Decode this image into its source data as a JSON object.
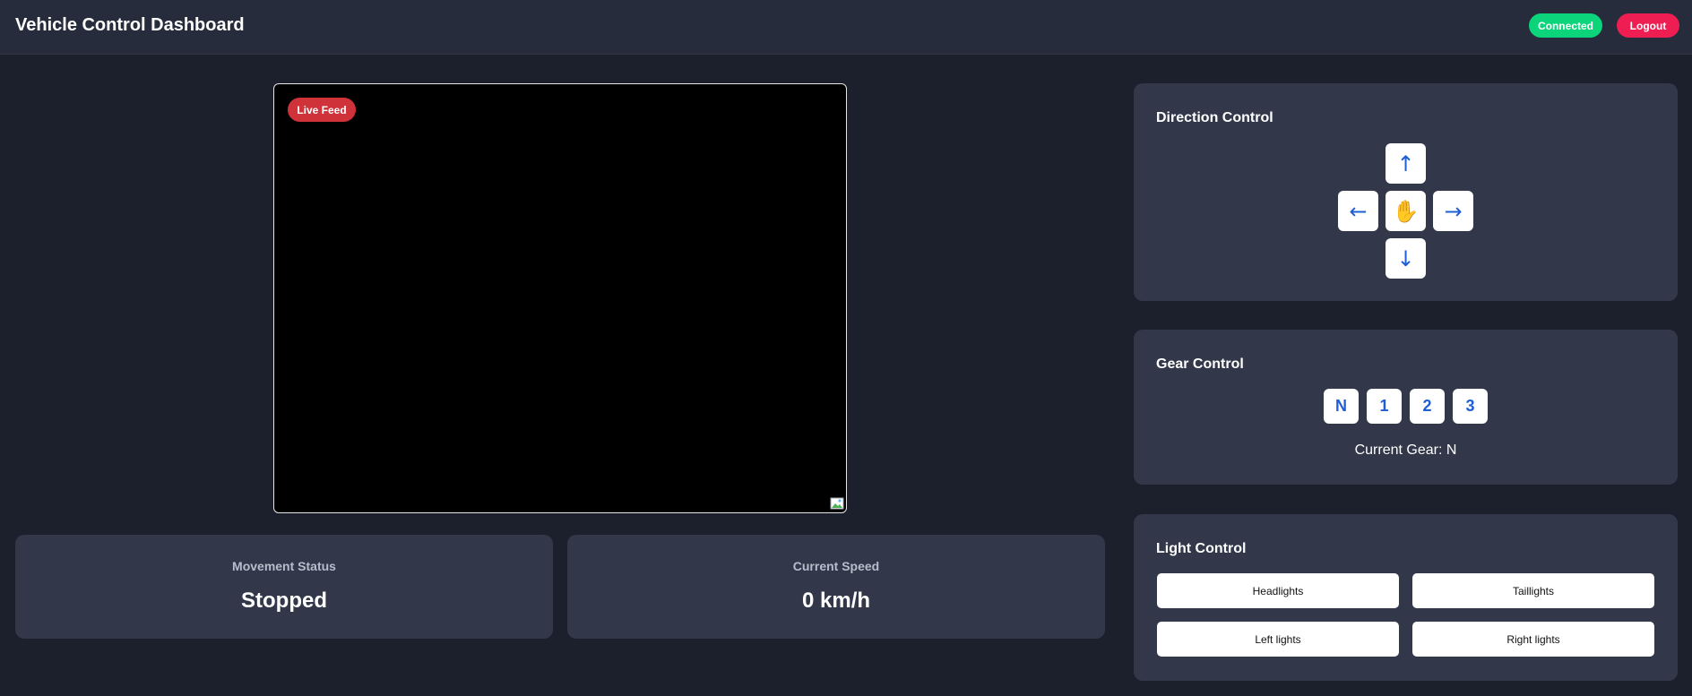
{
  "header": {
    "title": "Vehicle Control Dashboard",
    "status": "Connected",
    "logout_label": "Logout"
  },
  "video": {
    "badge": "Live Feed",
    "broken_image_icon": "broken-image-icon"
  },
  "stats": {
    "movement_label": "Movement Status",
    "movement_value": "Stopped",
    "speed_label": "Current Speed",
    "speed_value": "0 km/h"
  },
  "direction": {
    "title": "Direction Control",
    "up": "↑",
    "left": "←",
    "stop": "✋",
    "right": "→",
    "down": "↓"
  },
  "gear": {
    "title": "Gear Control",
    "options": [
      "N",
      "1",
      "2",
      "3"
    ],
    "current_text": "Current Gear: N"
  },
  "lights": {
    "title": "Light Control",
    "buttons": [
      "Headlights",
      "Taillights",
      "Left lights",
      "Right lights"
    ]
  },
  "colors": {
    "background": "#1b202c",
    "panel": "#323849",
    "connected": "#0bd47a",
    "logout": "#ee1d52",
    "live": "#cf3239",
    "accent": "#1f5fd4"
  }
}
